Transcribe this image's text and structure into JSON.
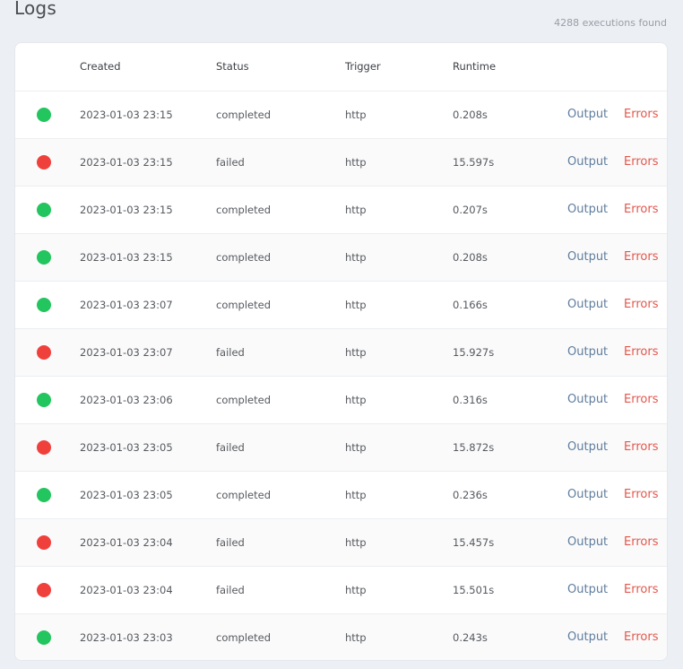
{
  "header": {
    "title": "Logs",
    "count": "4288 executions found"
  },
  "colors": {
    "completed": "#22c55e",
    "failed": "#f0403c"
  },
  "table": {
    "columns": [
      "Created",
      "Status",
      "Trigger",
      "Runtime"
    ],
    "output_label": "Output",
    "errors_label": "Errors",
    "rows": [
      {
        "created": "2023-01-03 23:15",
        "status": "completed",
        "trigger": "http",
        "runtime": "0.208s"
      },
      {
        "created": "2023-01-03 23:15",
        "status": "failed",
        "trigger": "http",
        "runtime": "15.597s"
      },
      {
        "created": "2023-01-03 23:15",
        "status": "completed",
        "trigger": "http",
        "runtime": "0.207s"
      },
      {
        "created": "2023-01-03 23:15",
        "status": "completed",
        "trigger": "http",
        "runtime": "0.208s"
      },
      {
        "created": "2023-01-03 23:07",
        "status": "completed",
        "trigger": "http",
        "runtime": "0.166s"
      },
      {
        "created": "2023-01-03 23:07",
        "status": "failed",
        "trigger": "http",
        "runtime": "15.927s"
      },
      {
        "created": "2023-01-03 23:06",
        "status": "completed",
        "trigger": "http",
        "runtime": "0.316s"
      },
      {
        "created": "2023-01-03 23:05",
        "status": "failed",
        "trigger": "http",
        "runtime": "15.872s"
      },
      {
        "created": "2023-01-03 23:05",
        "status": "completed",
        "trigger": "http",
        "runtime": "0.236s"
      },
      {
        "created": "2023-01-03 23:04",
        "status": "failed",
        "trigger": "http",
        "runtime": "15.457s"
      },
      {
        "created": "2023-01-03 23:04",
        "status": "failed",
        "trigger": "http",
        "runtime": "15.501s"
      },
      {
        "created": "2023-01-03 23:03",
        "status": "completed",
        "trigger": "http",
        "runtime": "0.243s"
      }
    ]
  }
}
